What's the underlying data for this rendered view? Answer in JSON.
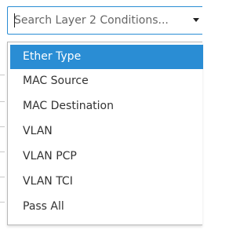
{
  "search": {
    "placeholder": "Search Layer 2 Conditions...",
    "value": ""
  },
  "dropdown": {
    "options": [
      {
        "label": "Ether Type",
        "highlighted": true
      },
      {
        "label": "MAC Source",
        "highlighted": false
      },
      {
        "label": "MAC Destination",
        "highlighted": false
      },
      {
        "label": "VLAN",
        "highlighted": false
      },
      {
        "label": "VLAN PCP",
        "highlighted": false
      },
      {
        "label": "VLAN TCI",
        "highlighted": false
      },
      {
        "label": "Pass All",
        "highlighted": false
      }
    ]
  },
  "colors": {
    "accent": "#2a8dd4",
    "highlight_text": "#ffffff",
    "text": "#333333",
    "border": "#b8b8b8"
  },
  "icons": {
    "dropdown_arrow": "caret-down-icon"
  }
}
